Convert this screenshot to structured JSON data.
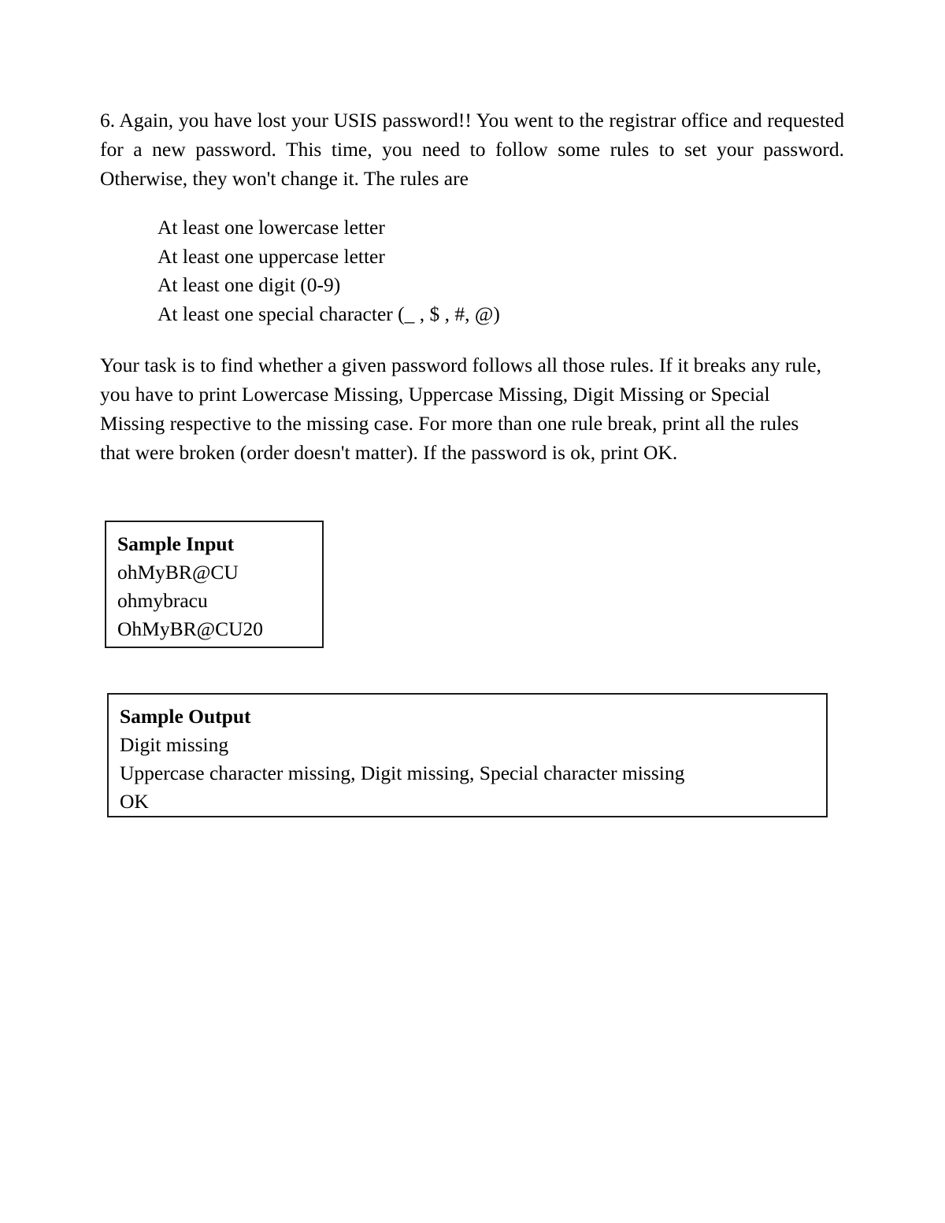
{
  "document": {
    "background_color": "#ffffff",
    "text_color": "#000000",
    "border_color": "#1a1a1a"
  },
  "problem": {
    "intro": "6. Again, you have lost your USIS password!! You went to the registrar office and requested for a new password. This time, you need to follow some rules to set your password. Otherwise, they won't change it. The rules are",
    "rules": [
      "At least one lowercase letter",
      "At least one uppercase letter",
      "At least one digit (0-9)",
      "At least one special character (_ , $ , #, @)"
    ],
    "task": "Your task is to find whether a given password follows all those rules. If it breaks any rule, you have to print Lowercase Missing, Uppercase Missing, Digit Missing or Special Missing respective to the missing case. For more than one rule break, print all the rules that were broken (order doesn't matter). If the password is ok, print OK."
  },
  "sample_input": {
    "title": "Sample Input",
    "lines": [
      "ohMyBR@CU",
      "ohmybracu",
      "OhMyBR@CU20"
    ]
  },
  "sample_output": {
    "title": "Sample Output",
    "lines": [
      "Digit missing",
      "Uppercase character missing, Digit missing, Special character missing",
      "OK"
    ]
  }
}
